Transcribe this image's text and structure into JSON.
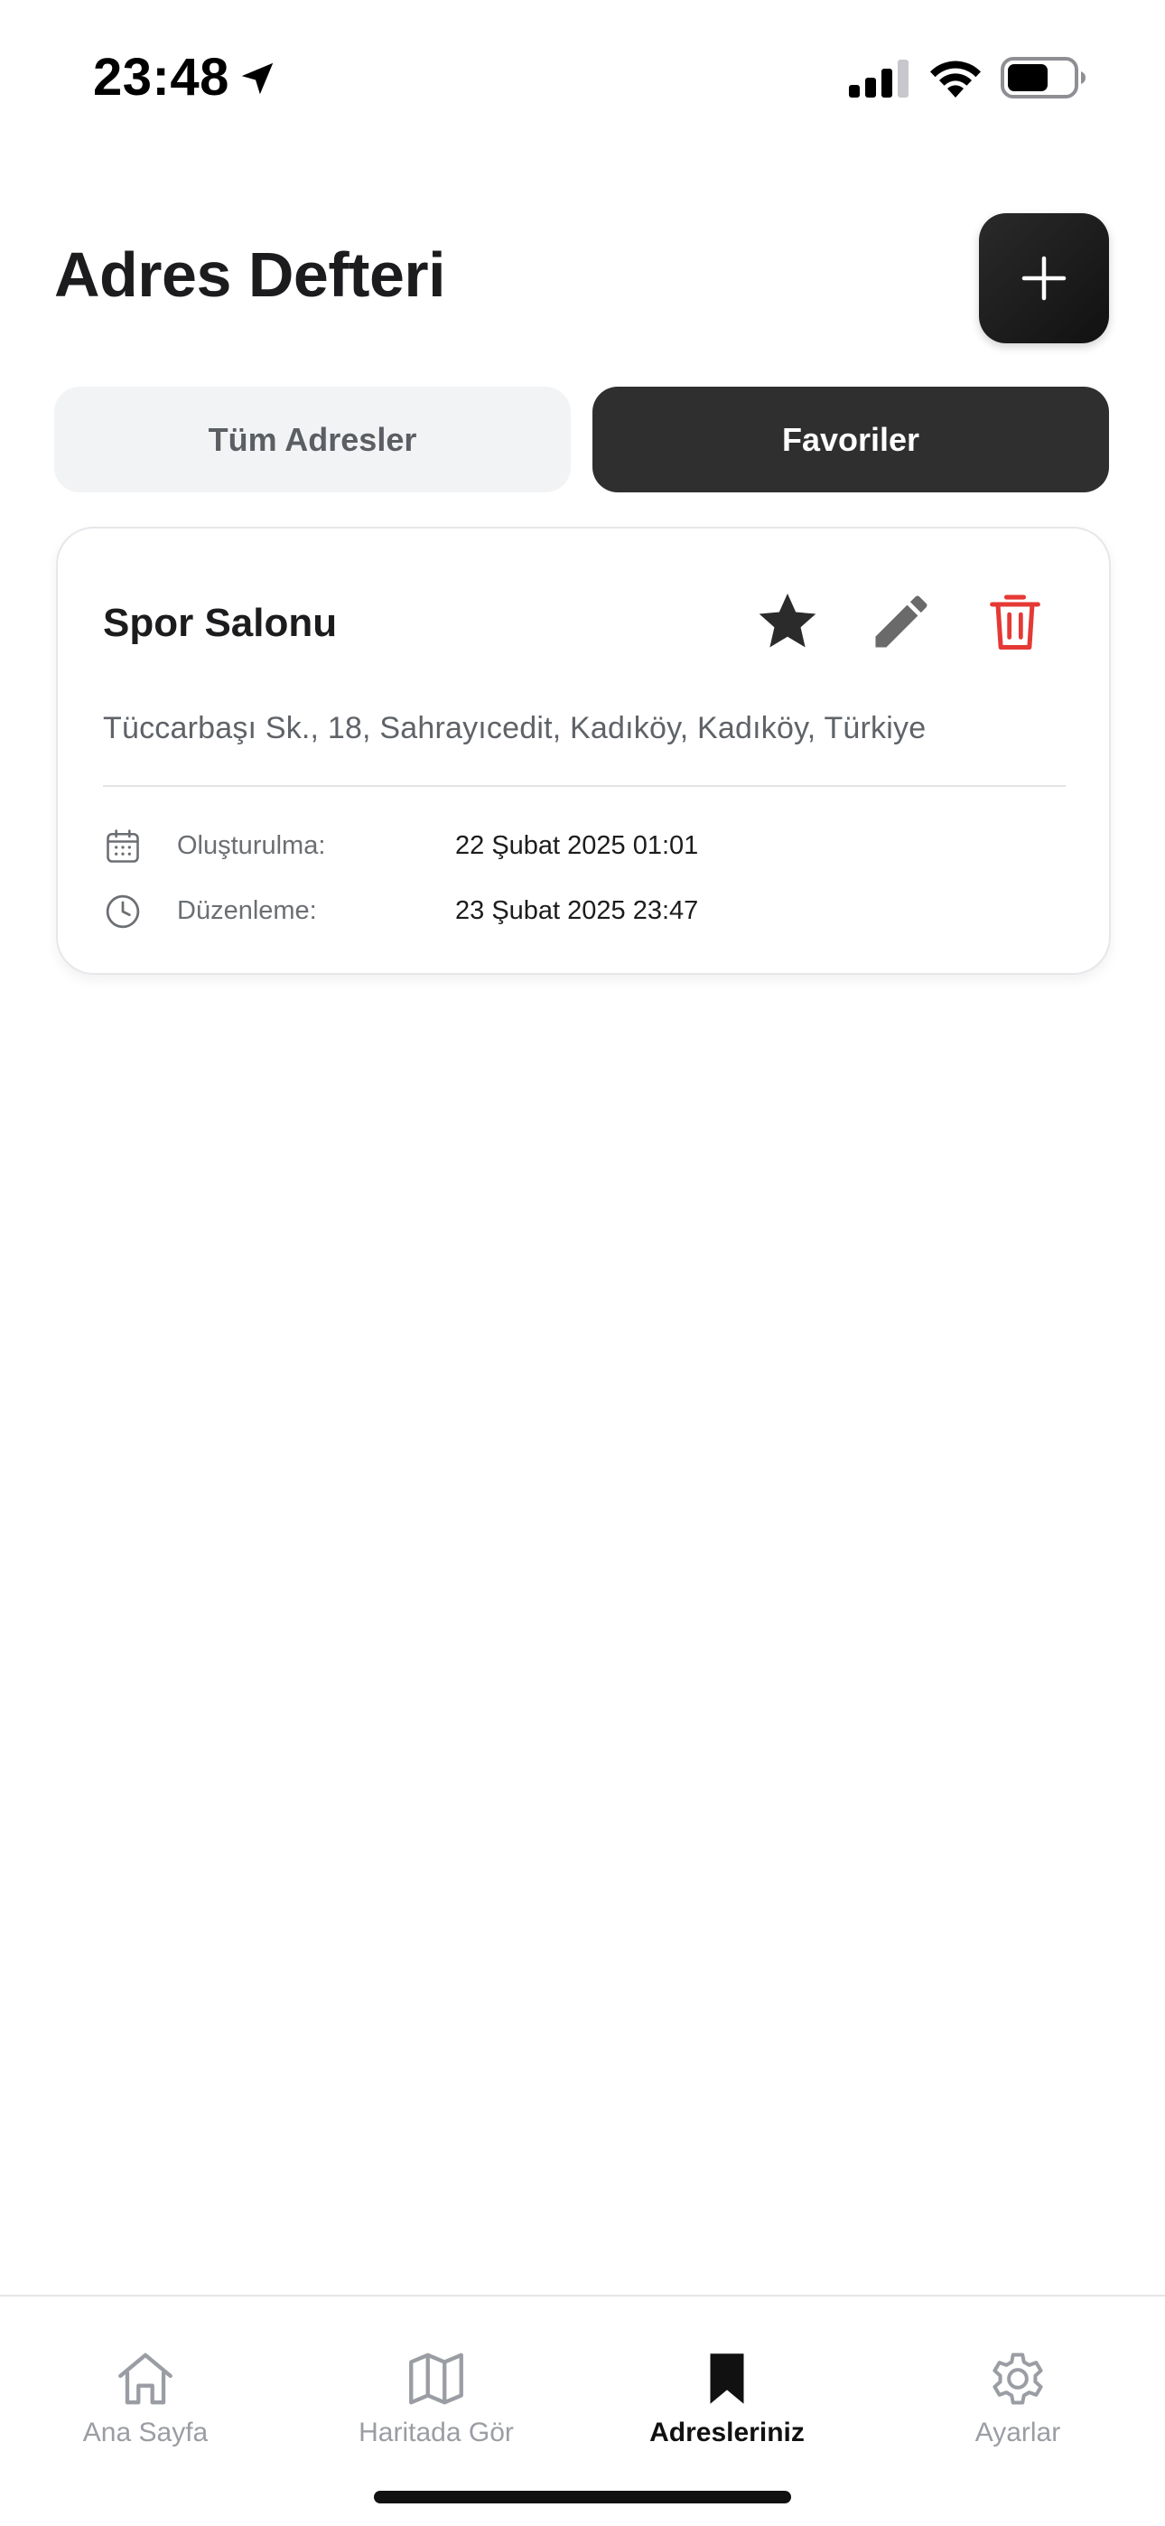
{
  "status_bar": {
    "time": "23:48",
    "icons": [
      "location-arrow-icon",
      "cellular-signal-icon",
      "wifi-icon",
      "battery-icon"
    ]
  },
  "header": {
    "title": "Adres Defteri",
    "add_button_icon": "plus-icon"
  },
  "tabs": [
    {
      "label": "Tüm Adresler",
      "selected": false
    },
    {
      "label": "Favoriler",
      "selected": true
    }
  ],
  "cards": [
    {
      "title": "Spor Salonu",
      "address": "Tüccarbaşı Sk., 18, Sahrayıcedit, Kadıköy, Kadıköy, Türkiye",
      "favorite": true,
      "actions": [
        "star-icon",
        "pencil-icon",
        "trash-icon"
      ],
      "created_label": "Oluşturulma:",
      "created_value": "22 Şubat 2025 01:01",
      "edited_label": "Düzenleme:",
      "edited_value": "23 Şubat 2025 23:47"
    }
  ],
  "bottom_nav": {
    "items": [
      {
        "label": "Ana Sayfa",
        "icon": "home-icon",
        "active": false
      },
      {
        "label": "Haritada Gör",
        "icon": "map-icon",
        "active": false
      },
      {
        "label": "Adresleriniz",
        "icon": "bookmark-icon",
        "active": true
      },
      {
        "label": "Ayarlar",
        "icon": "gear-icon",
        "active": false
      }
    ]
  },
  "colors": {
    "primary_dark": "#2f2f2f",
    "delete_red": "#e53935",
    "muted_text": "#5f6368",
    "inactive_tab_bg": "#f2f3f5"
  }
}
